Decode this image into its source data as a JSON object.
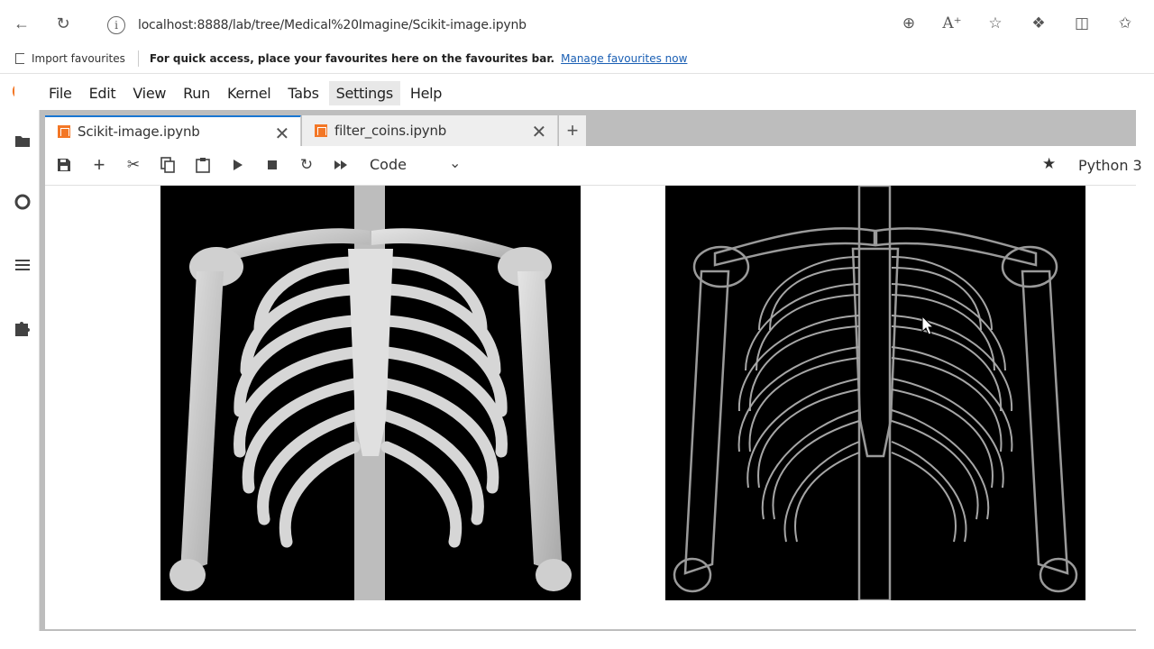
{
  "browser": {
    "url": "localhost:8888/lab/tree/Medical%20Imagine/Scikit-image.ipynb",
    "info_icon": "info-icon",
    "back_icon": "back-arrow-icon",
    "reload_icon": "reload-icon",
    "right_icons": [
      "zoom-icon",
      "read-aloud-icon",
      "favourite-star-icon",
      "extensions-icon",
      "split-screen-icon",
      "favourites-icon"
    ]
  },
  "favourites_bar": {
    "import_label": "Import favourites",
    "message": "For quick access, place your favourites here on the favourites bar.",
    "manage_link": "Manage favourites now"
  },
  "jupyter": {
    "menu": [
      "File",
      "Edit",
      "View",
      "Run",
      "Kernel",
      "Tabs",
      "Settings",
      "Help"
    ],
    "active_menu": "Settings",
    "tabs": [
      {
        "label": "Scikit-image.ipynb",
        "active": true
      },
      {
        "label": "filter_coins.ipynb",
        "active": false
      }
    ],
    "toolbar": {
      "cell_type": "Code",
      "kernel": "Python 3"
    },
    "accent_color": "#1976d2",
    "brand_color": "#f37726"
  },
  "outputs": {
    "left_image": "original-chest-skeleton-image",
    "right_image": "edge-filtered-chest-skeleton-image"
  }
}
